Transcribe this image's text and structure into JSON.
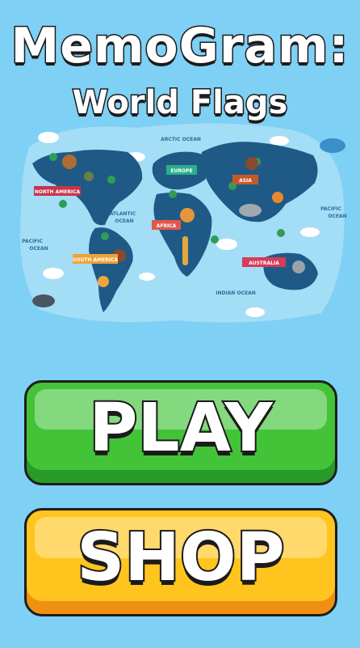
{
  "title": {
    "main": "MemoGram:",
    "sub": "World Flags"
  },
  "map": {
    "oceans": [
      "ARCTIC OCEAN",
      "ATLANTIC OCEAN",
      "PACIFIC OCEAN",
      "PACIFIC OCEAN",
      "INDIAN OCEAN"
    ],
    "atlantic_1": "ATLANTIC",
    "atlantic_2": "OCEAN",
    "pacific_left_1": "PACIFIC",
    "pacific_left_2": "OCEAN",
    "pacific_right_1": "PACIFIC",
    "pacific_right_2": "OCEAN",
    "arctic": "ARCTIC OCEAN",
    "indian": "INDIAN OCEAN",
    "continents": {
      "north_america": "NORTH AMERICA",
      "south_america": "SOUTH AMERICA",
      "europe": "EUROPE",
      "africa": "AFRICA",
      "asia": "ASIA",
      "australia": "AUSTRALIA"
    }
  },
  "buttons": {
    "play": "PLAY",
    "shop": "SHOP"
  },
  "colors": {
    "background": "#7fd0f5",
    "land": "#1f5a86",
    "play": "#43c338",
    "shop": "#ffc51e"
  }
}
